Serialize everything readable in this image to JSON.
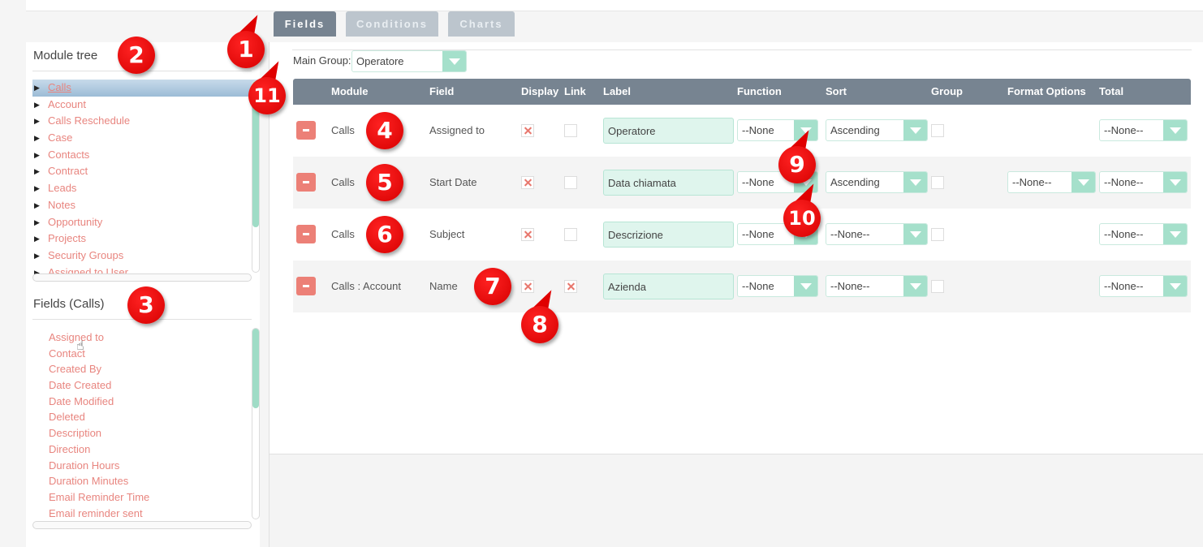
{
  "tabs": [
    {
      "label": "Fields",
      "active": true
    },
    {
      "label": "Conditions",
      "active": false
    },
    {
      "label": "Charts",
      "active": false
    }
  ],
  "module_tree": {
    "title": "Module tree",
    "items": [
      {
        "label": "Calls",
        "selected": true
      },
      {
        "label": "Account"
      },
      {
        "label": "Calls Reschedule"
      },
      {
        "label": "Case"
      },
      {
        "label": "Contacts"
      },
      {
        "label": "Contract"
      },
      {
        "label": "Leads"
      },
      {
        "label": "Notes"
      },
      {
        "label": "Opportunity"
      },
      {
        "label": "Projects"
      },
      {
        "label": "Security Groups"
      },
      {
        "label": "Assigned to User"
      }
    ]
  },
  "fields_panel": {
    "title": "Fields (Calls)",
    "items": [
      "Assigned to",
      "Contact",
      "Created By",
      "Date Created",
      "Date Modified",
      "Deleted",
      "Description",
      "Direction",
      "Duration Hours",
      "Duration Minutes",
      "Email Reminder Time",
      "Email reminder sent"
    ]
  },
  "main_group": {
    "label": "Main Group:",
    "value": "Operatore"
  },
  "table": {
    "headers": {
      "module": "Module",
      "field": "Field",
      "display": "Display",
      "link": "Link",
      "label": "Label",
      "function": "Function",
      "sort": "Sort",
      "group": "Group",
      "format": "Format Options",
      "total": "Total"
    },
    "rows": [
      {
        "module": "Calls",
        "field": "Assigned to",
        "display": true,
        "link": false,
        "label": "Operatore",
        "function": "--None",
        "sort": "Ascending",
        "group": false,
        "format": null,
        "total": "--None--"
      },
      {
        "module": "Calls",
        "field": "Start Date",
        "display": true,
        "link": false,
        "label": "Data chiamata",
        "function": "--None",
        "sort": "Ascending",
        "group": false,
        "format": "--None--",
        "total": "--None--"
      },
      {
        "module": "Calls",
        "field": "Subject",
        "display": true,
        "link": false,
        "label": "Descrizione",
        "function": "--None",
        "sort": "--None--",
        "group": false,
        "format": null,
        "total": "--None--"
      },
      {
        "module": "Calls : Account",
        "field": "Name",
        "display": true,
        "link": true,
        "label": "Azienda",
        "function": "--None",
        "sort": "--None--",
        "group": false,
        "format": null,
        "total": "--None--"
      }
    ]
  },
  "annotations": [
    "1",
    "2",
    "3",
    "4",
    "5",
    "6",
    "7",
    "8",
    "9",
    "10",
    "11"
  ],
  "colors": {
    "accent_teal": "#a5e0cb",
    "link_salmon": "#e8857f",
    "header_slate": "#778491",
    "marker_red": "#e00000"
  }
}
